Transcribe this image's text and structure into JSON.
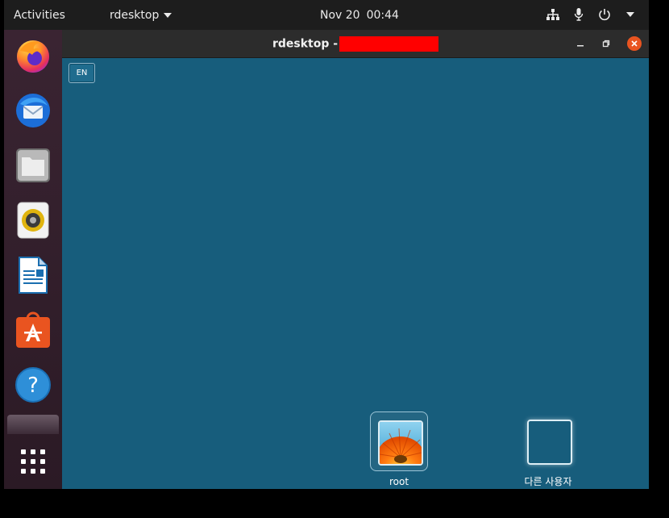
{
  "topbar": {
    "activities": "Activities",
    "app_name": "rdesktop",
    "date": "Nov 20",
    "time": "00:44",
    "tray_icons": [
      "network-icon",
      "microphone-icon",
      "power-icon",
      "chevron-down-icon"
    ]
  },
  "dock": {
    "apps": [
      "firefox-icon",
      "thunderbird-icon",
      "files-icon",
      "rhythmbox-icon",
      "libreoffice-writer-icon",
      "software-center-icon",
      "help-icon",
      "show-apps-icon"
    ]
  },
  "window": {
    "title_prefix": "rdesktop -",
    "language_indicator": "EN",
    "users": [
      {
        "name": "root"
      },
      {
        "name": "다른 사용자"
      }
    ]
  },
  "colors": {
    "desktop_bg": "#175d7c",
    "accent": "#e95420",
    "redaction": "#ff0000"
  }
}
